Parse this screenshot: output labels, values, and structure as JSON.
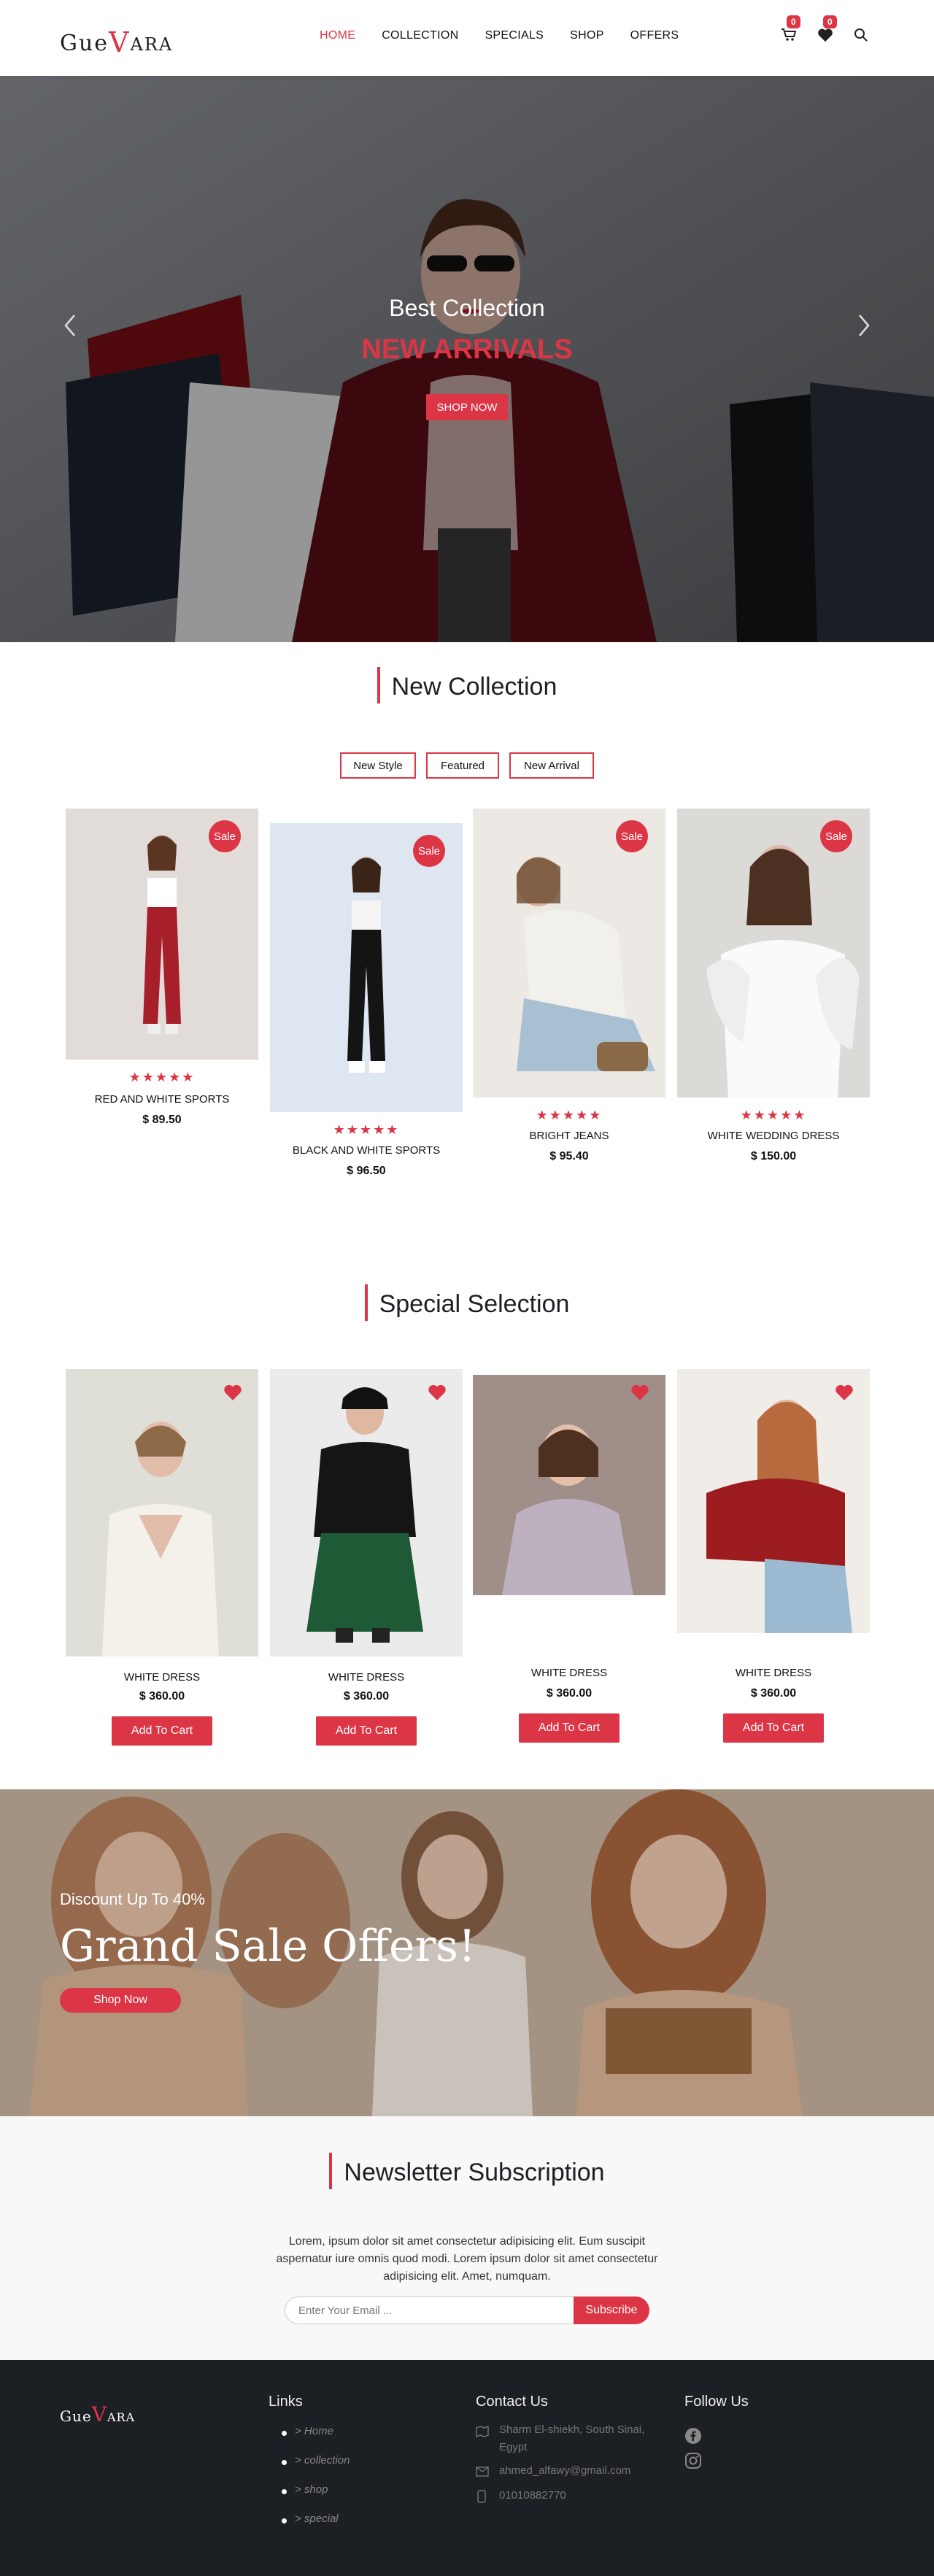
{
  "header": {
    "logo": {
      "part1": "Gue",
      "v": "V",
      "part2": "ara"
    },
    "nav": [
      "HOME",
      "COLLECTION",
      "SPECIALS",
      "SHOP",
      "OFFERS"
    ],
    "cart_count": "0",
    "wishlist_count": "0"
  },
  "hero": {
    "subtitle": "Best Collection",
    "title": "NEW ARRIVALS",
    "button": "SHOP NOW"
  },
  "new_collection": {
    "title": "New Collection",
    "filters": [
      "New Style",
      "Featured",
      "New Arrival"
    ],
    "sale_label": "Sale",
    "products": [
      {
        "name": "RED AND WHITE SPORTS",
        "price": "$ 89.50",
        "stars": "★★★★★"
      },
      {
        "name": "BLACK AND WHITE SPORTS",
        "price": "$ 96.50",
        "stars": "★★★★★"
      },
      {
        "name": "BRIGHT JEANS",
        "price": "$ 95.40",
        "stars": "★★★★★"
      },
      {
        "name": "WHITE WEDDING DRESS",
        "price": "$ 150.00",
        "stars": "★★★★★"
      }
    ]
  },
  "special": {
    "title": "Special Selection",
    "button": "Add To Cart",
    "products": [
      {
        "name": "WHITE DRESS",
        "price": "$ 360.00"
      },
      {
        "name": "WHITE DRESS",
        "price": "$ 360.00"
      },
      {
        "name": "WHITE DRESS",
        "price": "$ 360.00"
      },
      {
        "name": "WHITE DRESS",
        "price": "$ 360.00"
      }
    ]
  },
  "banner": {
    "small": "Discount Up To 40%",
    "big": "Grand Sale Offers!",
    "button": "Shop Now"
  },
  "newsletter": {
    "title": "Newsletter Subscription",
    "text": "Lorem, ipsum dolor sit amet consectetur adipisicing elit. Eum suscipit aspernatur iure omnis quod modi. Lorem ipsum dolor sit amet consectetur adipisicing elit. Amet, numquam.",
    "placeholder": "Enter Your Email ...",
    "button": "Subscribe"
  },
  "footer": {
    "logo": {
      "part1": "Gue",
      "v": "V",
      "part2": "ara"
    },
    "links_title": "Links",
    "links": [
      "> Home",
      "> collection",
      "> shop",
      "> special"
    ],
    "contact_title": "Contact Us",
    "address_line1": "Sharm El-shiekh, South Sinai,",
    "address_line2": "Egypt",
    "email": "ahmed_alfawy@gmail.com",
    "phone": "01010882770",
    "follow_title": "Follow Us"
  },
  "colors": {
    "accent": "#dc3545",
    "dark": "#1c1f24"
  }
}
